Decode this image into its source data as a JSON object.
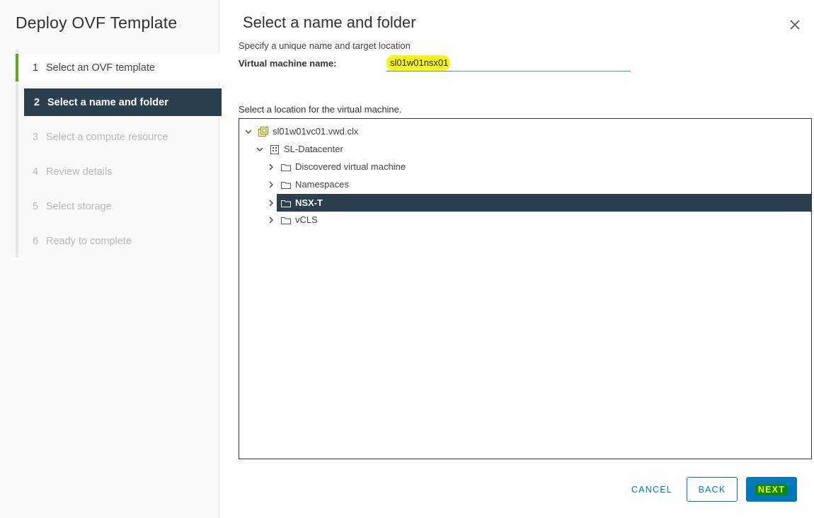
{
  "wizard": {
    "title": "Deploy OVF Template",
    "steps": [
      {
        "num": "1",
        "label": "Select an OVF template",
        "state": "done"
      },
      {
        "num": "2",
        "label": "Select a name and folder",
        "state": "active"
      },
      {
        "num": "3",
        "label": "Select a compute resource",
        "state": "pending"
      },
      {
        "num": "4",
        "label": "Review details",
        "state": "pending"
      },
      {
        "num": "5",
        "label": "Select storage",
        "state": "pending"
      },
      {
        "num": "6",
        "label": "Ready to complete",
        "state": "pending"
      }
    ]
  },
  "page": {
    "title": "Select a name and folder",
    "subtitle": "Specify a unique name and target location",
    "vm_name_label": "Virtual machine name:",
    "vm_name_value": "sl01w01nsx01",
    "location_label": "Select a location for the virtual machine."
  },
  "tree": {
    "vcenter": "sl01w01vc01.vwd.clx",
    "datacenter": "SL-Datacenter",
    "folders": [
      {
        "label": "Discovered virtual machine",
        "selected": false
      },
      {
        "label": "Namespaces",
        "selected": false
      },
      {
        "label": "NSX-T",
        "selected": true
      },
      {
        "label": "vCLS",
        "selected": false
      }
    ]
  },
  "footer": {
    "cancel": "CANCEL",
    "back": "BACK",
    "next": "NEXT"
  },
  "colors": {
    "accent": "#0079b8",
    "active_step_bg": "#2b3f4f",
    "done_indicator": "#62a420",
    "highlight": "#f7f500"
  }
}
